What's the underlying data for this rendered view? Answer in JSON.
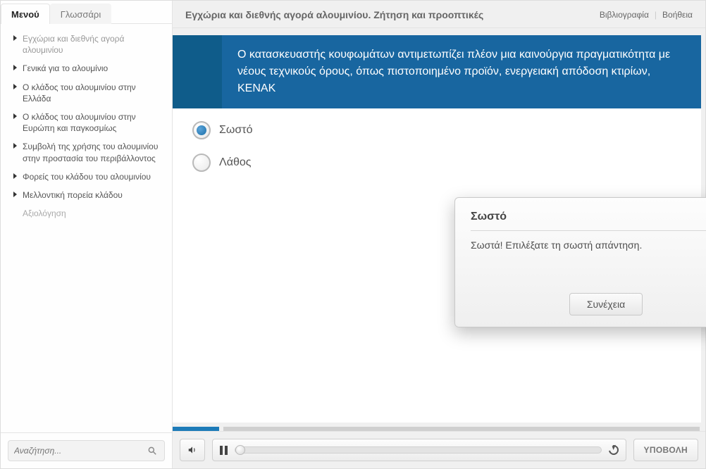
{
  "tabs": {
    "menu": "Μενού",
    "glossary": "Γλωσσάρι"
  },
  "sidebar": {
    "items": [
      {
        "label": "Εγχώρια και διεθνής αγορά αλουμινίου"
      },
      {
        "label": "Γενικά για το αλουμίνιο"
      },
      {
        "label": "Ο κλάδος του αλουμινίου στην Ελλάδα"
      },
      {
        "label": "Ο κλάδος του αλουμινίου στην Ευρώπη και παγκοσμίως"
      },
      {
        "label": "Συμβολή της χρήσης του αλουμινίου στην προστασία του περιβάλλοντος"
      },
      {
        "label": "Φορείς του κλάδου του αλουμινίου"
      },
      {
        "label": "Μελλοντική πορεία κλάδου"
      },
      {
        "label": "Αξιολόγηση"
      }
    ],
    "search_placeholder": "Αναζήτηση..."
  },
  "header": {
    "title": "Εγχώρια και διεθνής αγορά αλουμινίου. Ζήτηση και προοπτικές",
    "links": {
      "bibliography": "Βιβλιογραφία",
      "help": "Βοήθεια"
    }
  },
  "question": {
    "prompt": "Ο κατασκευαστής κουφωμάτων αντιμετωπίζει πλέον μια καινούργια πραγματικότητα με νέους τεχνικούς όρους, όπως πιστοποιημένο προϊόν, ενεργειακή απόδοση κτιρίων, KENAK",
    "options": {
      "correct": "Σωστό",
      "wrong": "Λάθος"
    }
  },
  "feedback": {
    "title": "Σωστό",
    "text": "Σωστά!  Επιλέξατε τη σωστή απάντηση.",
    "continue": "Συνέχεια"
  },
  "controls": {
    "submit": "ΥΠΟΒΟΛΗ"
  }
}
